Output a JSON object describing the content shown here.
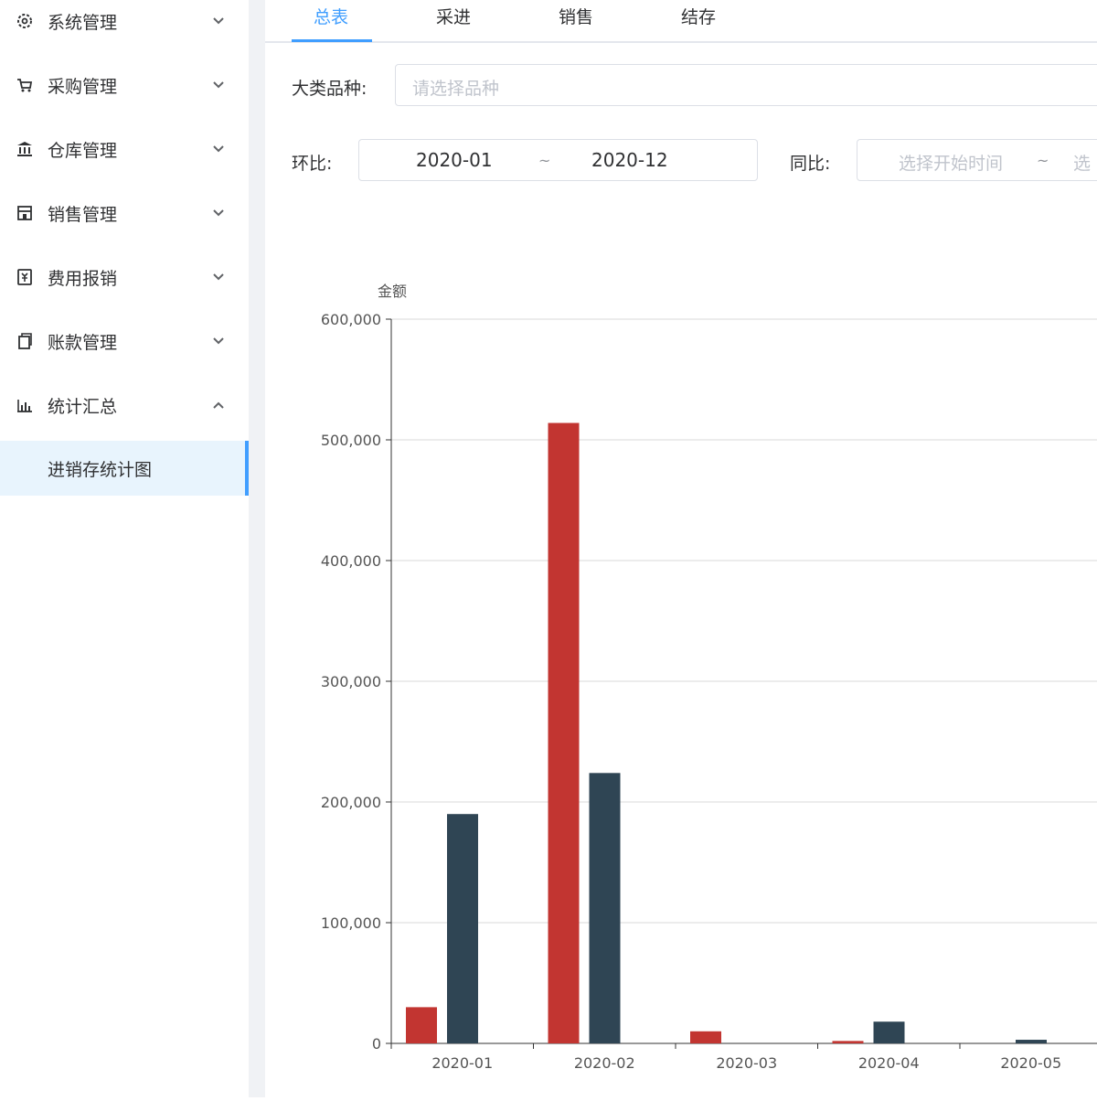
{
  "sidebar": {
    "items": [
      {
        "label": "系统管理",
        "icon": "gear-icon"
      },
      {
        "label": "采购管理",
        "icon": "cart-icon"
      },
      {
        "label": "仓库管理",
        "icon": "bank-icon"
      },
      {
        "label": "销售管理",
        "icon": "store-icon"
      },
      {
        "label": "费用报销",
        "icon": "yuan-receipt-icon"
      },
      {
        "label": "账款管理",
        "icon": "copy-document-icon"
      },
      {
        "label": "统计汇总",
        "icon": "bar-chart-icon"
      }
    ],
    "active_sub_item": "进销存统计图"
  },
  "tabs": [
    "总表",
    "采进",
    "销售",
    "结存"
  ],
  "active_tab": "总表",
  "filters": {
    "category_label": "大类品种:",
    "category_placeholder": "请选择品种",
    "mom_label": "环比:",
    "mom_start": "2020-01",
    "mom_sep": "~",
    "mom_end": "2020-12",
    "yoy_label": "同比:",
    "yoy_start_placeholder": "选择开始时间",
    "yoy_sep": "~",
    "yoy_end_placeholder": "选"
  },
  "colors": {
    "accent": "#409eff",
    "active_bg": "#e8f4fd",
    "series_red": "#c23531",
    "series_dark": "#2f4554"
  },
  "chart_data": {
    "type": "bar",
    "ylabel": "金额",
    "ylim": [
      0,
      600000
    ],
    "yticks": [
      "0",
      "100,000",
      "200,000",
      "300,000",
      "400,000",
      "500,000",
      "600,000"
    ],
    "categories": [
      "2020-01",
      "2020-02",
      "2020-03",
      "2020-04",
      "2020-05"
    ],
    "series": [
      {
        "color": "#c23531",
        "values": [
          30000,
          514000,
          10000,
          2000,
          0
        ]
      },
      {
        "color": "#2f4554",
        "values": [
          190000,
          224000,
          0,
          18000,
          3000
        ]
      }
    ],
    "grid": true
  }
}
